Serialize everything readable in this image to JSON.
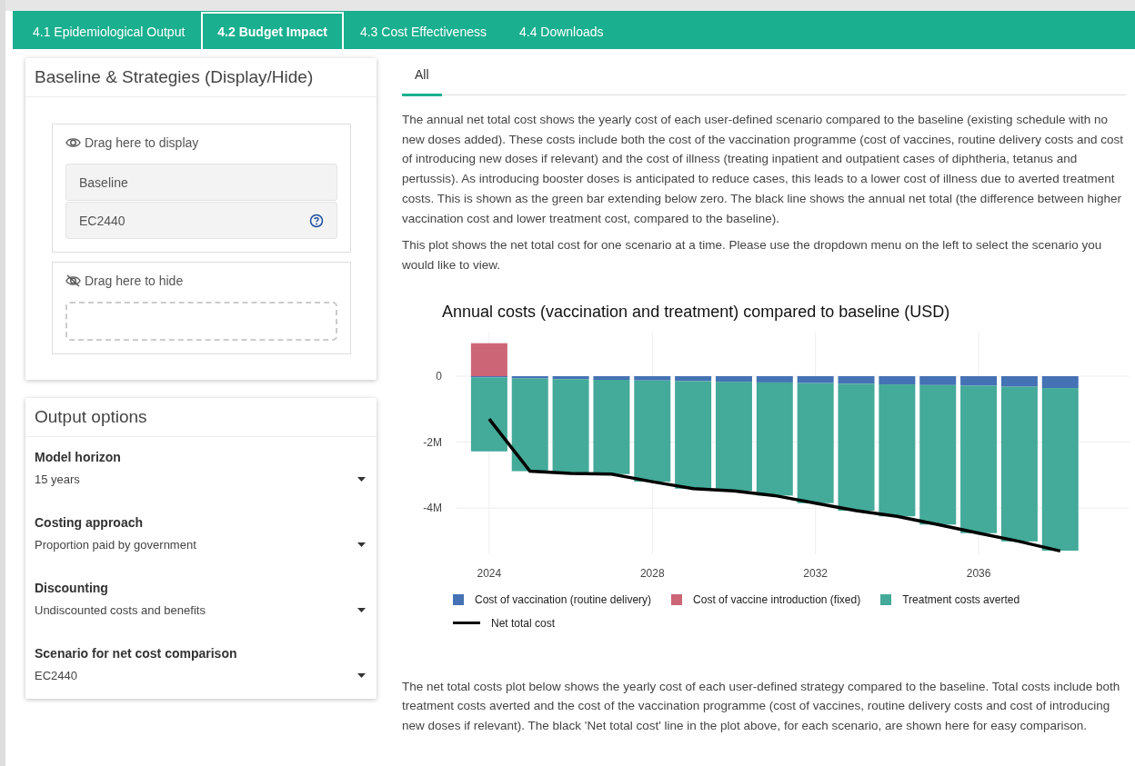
{
  "tabs": [
    {
      "label": "4.1 Epidemiological Output",
      "selected": false
    },
    {
      "label": "4.2 Budget Impact",
      "selected": true
    },
    {
      "label": "4.3 Cost Effectiveness",
      "selected": false
    },
    {
      "label": "4.4 Downloads",
      "selected": false
    }
  ],
  "strategy_panel": {
    "title": "Baseline & Strategies (Display/Hide)",
    "display_zone": {
      "label": "Drag here to display",
      "items": [
        {
          "label": "Baseline",
          "help": false
        },
        {
          "label": "EC2440",
          "help": true
        }
      ]
    },
    "hide_zone": {
      "label": "Drag here to hide"
    }
  },
  "output_options": {
    "title": "Output options",
    "fields": [
      {
        "label": "Model horizon",
        "value": "15 years"
      },
      {
        "label": "Costing approach",
        "value": "Proportion paid by government"
      },
      {
        "label": "Discounting",
        "value": "Undiscounted costs and benefits"
      },
      {
        "label": "Scenario for net cost comparison",
        "value": "EC2440"
      }
    ]
  },
  "subtabs": [
    {
      "label": "All",
      "selected": true
    }
  ],
  "paragraphs": [
    "The annual net total cost shows the yearly cost of each user-defined scenario compared to the baseline (existing schedule with no new doses added). These costs include both the cost of the vaccination programme (cost of vaccines, routine delivery costs and cost of introducing new doses if relevant) and the cost of illness (treating inpatient and outpatient cases of diphtheria, tetanus and pertussis). As introducing booster doses is anticipated to reduce cases, this leads to a lower cost of illness due to averted treatment costs. This is shown as the green bar extending below zero. The black line shows the annual net total (the difference between higher vaccination cost and lower treatment cost, compared to the baseline).",
    "This plot shows the net total cost for one scenario at a time. Please use the dropdown menu on the left to select the scenario you would like to view."
  ],
  "chart": {
    "chart_data": {
      "type": "bar",
      "stacked": true,
      "title": "Annual costs (vaccination and treatment) compared to baseline (USD)",
      "x": [
        2024,
        2025,
        2026,
        2027,
        2028,
        2029,
        2030,
        2031,
        2032,
        2033,
        2034,
        2035,
        2036,
        2037,
        2038
      ],
      "series": [
        {
          "name": "Cost of vaccination (routine delivery)",
          "color": "#4472b4",
          "values": [
            -40000,
            -70000,
            -90000,
            -110000,
            -130000,
            -150000,
            -170000,
            -190000,
            -210000,
            -230000,
            -250000,
            -270000,
            -290000,
            -320000,
            -360000
          ]
        },
        {
          "name": "Cost of vaccine introduction (fixed)",
          "color": "#cc6677",
          "values": [
            1000000,
            0,
            0,
            0,
            0,
            0,
            0,
            0,
            0,
            0,
            0,
            0,
            0,
            0,
            0
          ]
        },
        {
          "name": "Treatment costs averted",
          "color": "#44aa99",
          "values": [
            -2240000,
            -2810000,
            -2830000,
            -2860000,
            -3070000,
            -3260000,
            -3310000,
            -3430000,
            -3640000,
            -3850000,
            -4000000,
            -4230000,
            -4470000,
            -4690000,
            -4930000
          ]
        },
        {
          "name": "Net total cost",
          "color": "#000000",
          "type": "line",
          "values": [
            -1300000,
            -2880000,
            -2950000,
            -2970000,
            -3200000,
            -3410000,
            -3480000,
            -3620000,
            -3850000,
            -4080000,
            -4250000,
            -4500000,
            -4760000,
            -5010000,
            -5300000
          ]
        }
      ],
      "grid": true,
      "legend": "bottom",
      "xlim": [
        2023.2,
        2039.7
      ],
      "ylim": [
        -5400000,
        1350000
      ],
      "xticks": [
        2024,
        2028,
        2032,
        2036
      ],
      "yticks": [
        {
          "value": 0,
          "label": "0"
        },
        {
          "value": -2000000,
          "label": "-2M"
        },
        {
          "value": -4000000,
          "label": "-4M"
        }
      ]
    }
  },
  "footer_paragraph": "The net total costs plot below shows the yearly cost of each user-defined strategy compared to the baseline. Total costs include both treatment costs averted and the cost of the vaccination programme (cost of vaccines, routine delivery costs and cost of introducing new doses if relevant). The black 'Net total cost' line in the plot above, for each scenario, are shown here for easy comparison."
}
